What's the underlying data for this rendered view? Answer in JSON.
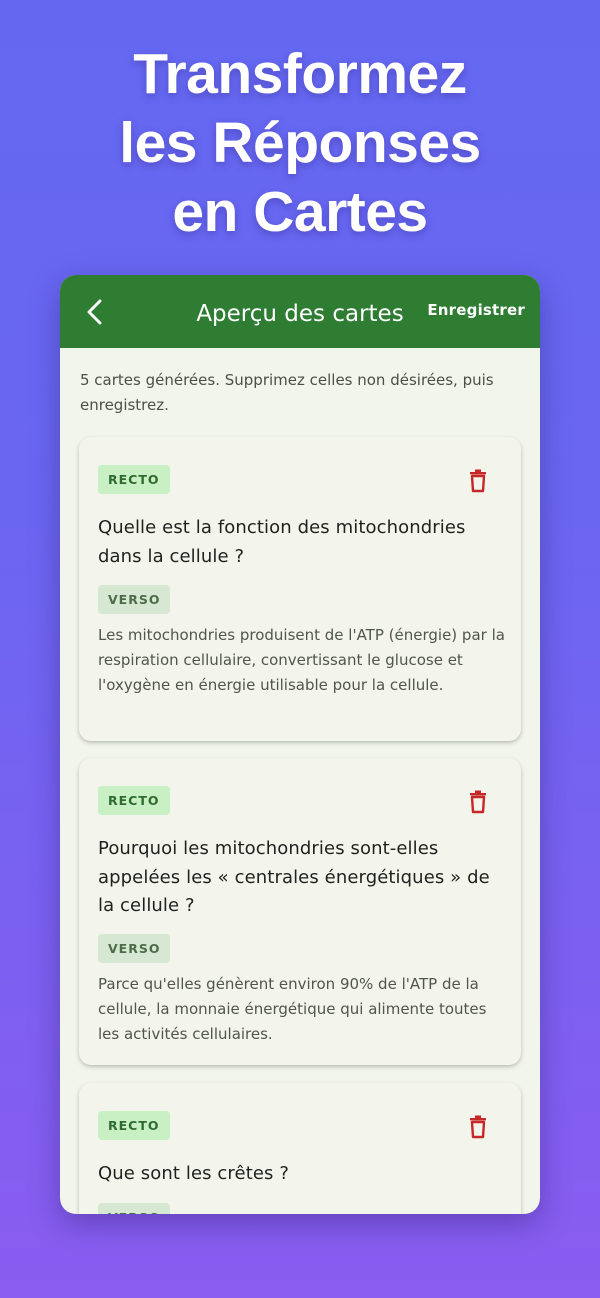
{
  "hero": {
    "line1": "Transformez",
    "line2": "les Réponses",
    "line3": "en Cartes"
  },
  "appbar": {
    "back_icon": "chevron-left-icon",
    "title": "Aperçu des cartes",
    "save_label": "Enregistrer"
  },
  "info": "5 cartes générées. Supprimez celles non désirées, puis enregistrez.",
  "cards": [
    {
      "front_label": "RECTO",
      "question": "Quelle est la fonction des mitochondries dans la cellule ?",
      "back_label": "VERSO",
      "answer": "Les mitochondries produisent de l'ATP (énergie) par la respiration cellulaire, convertissant le glucose et l'oxygène en énergie utilisable pour la cellule."
    },
    {
      "front_label": "RECTO",
      "question": "Pourquoi les mitochondries sont-elles appelées les « centrales énergétiques » de la cellule ?",
      "back_label": "VERSO",
      "answer": "Parce qu'elles génèrent environ 90% de l'ATP de la cellule, la monnaie énergétique qui alimente toutes les activités cellulaires."
    },
    {
      "front_label": "RECTO",
      "question": "Que sont les crêtes ?",
      "back_label": "VERSO",
      "answer": ""
    }
  ],
  "colors": {
    "primary": "#2e7d32",
    "delete": "#c62828",
    "background_top": "#6468f1",
    "background_bottom": "#8a5cf0"
  }
}
